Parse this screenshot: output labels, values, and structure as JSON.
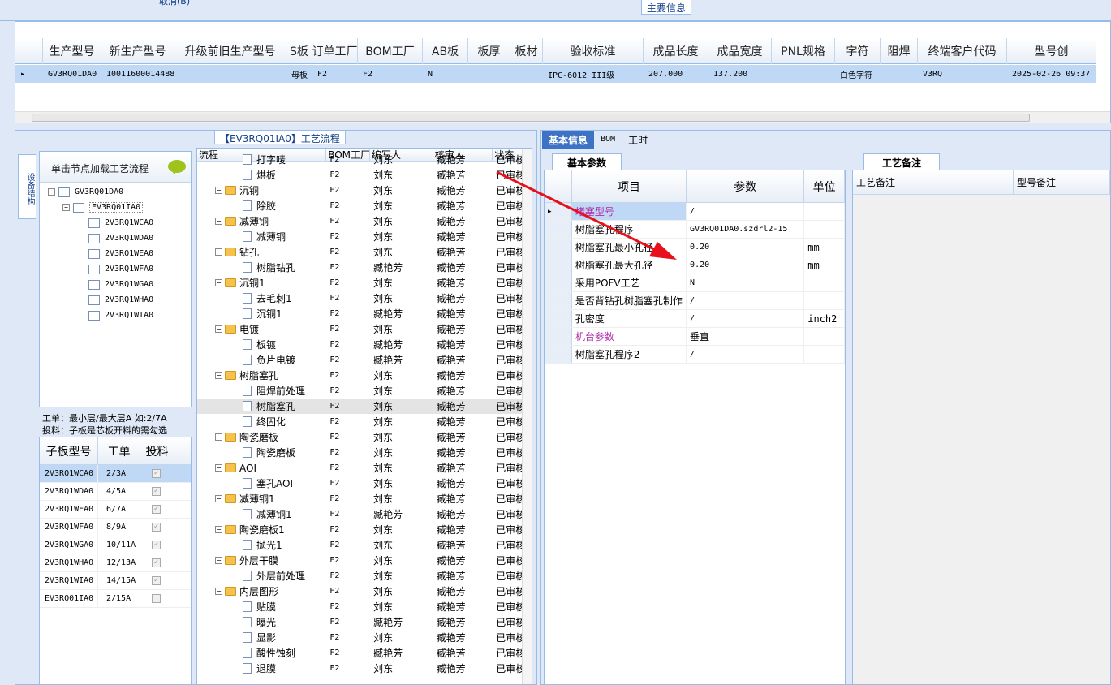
{
  "top": {
    "cancel_label": "取消(B)"
  },
  "main_info": {
    "title": "主要信息",
    "headers": [
      "生产型号",
      "新生产型号",
      "升级前旧生产型号",
      "S板",
      "订单工厂",
      "BOM工厂",
      "AB板",
      "板厚",
      "板材",
      "验收标准",
      "成品长度",
      "成品宽度",
      "PNL规格",
      "字符",
      "阻焊",
      "终端客户代码",
      "型号创"
    ],
    "row": [
      "GV3RQ01DA0",
      "10011600014488",
      "",
      "母板",
      "F2",
      "F2",
      "N",
      "",
      "",
      "IPC-6012 III级",
      "207.000",
      "137.200",
      "",
      "白色字符",
      "",
      "V3RQ",
      "2025-02-26 09:37"
    ]
  },
  "left": {
    "flow_title": "【EV3RQ01IA0】工艺流程",
    "vtab_label": "设备结构",
    "tree_header": "单击节点加载工艺流程",
    "tree": {
      "root": "GV3RQ01DA0",
      "child": "EV3RQ01IA0",
      "leaves": [
        "2V3RQ1WCA0",
        "2V3RQ1WDA0",
        "2V3RQ1WEA0",
        "2V3RQ1WFA0",
        "2V3RQ1WGA0",
        "2V3RQ1WHA0",
        "2V3RQ1WIA0"
      ]
    },
    "info_line1": "工单：最小层/最大层A 如:2/7A",
    "info_line2": "投料：子板是芯板开料的需勾选",
    "sub_grid": {
      "headers": [
        "子板型号",
        "工单",
        "投料"
      ],
      "rows": [
        {
          "model": "2V3RQ1WCA0",
          "order": "2/3A",
          "checked": true
        },
        {
          "model": "2V3RQ1WDA0",
          "order": "4/5A",
          "checked": true
        },
        {
          "model": "2V3RQ1WEA0",
          "order": "6/7A",
          "checked": true
        },
        {
          "model": "2V3RQ1WFA0",
          "order": "8/9A",
          "checked": true
        },
        {
          "model": "2V3RQ1WGA0",
          "order": "10/11A",
          "checked": true
        },
        {
          "model": "2V3RQ1WHA0",
          "order": "12/13A",
          "checked": true
        },
        {
          "model": "2V3RQ1WIA0",
          "order": "14/15A",
          "checked": true
        },
        {
          "model": "EV3RQ01IA0",
          "order": "2/15A",
          "checked": false
        }
      ]
    }
  },
  "process": {
    "headers": [
      "流程",
      "BOM工厂",
      "编写人",
      "核审人",
      "状态"
    ],
    "rows": [
      {
        "level": 2,
        "name": "打字唛",
        "bom": "F2",
        "writer": "刘东",
        "auditor": "臧艳芳",
        "status": "已审核"
      },
      {
        "level": 2,
        "name": "烘板",
        "bom": "F2",
        "writer": "刘东",
        "auditor": "臧艳芳",
        "status": "已审核"
      },
      {
        "level": 1,
        "name": "沉铜",
        "bom": "F2",
        "writer": "刘东",
        "auditor": "臧艳芳",
        "status": "已审核"
      },
      {
        "level": 2,
        "name": "除胶",
        "bom": "F2",
        "writer": "刘东",
        "auditor": "臧艳芳",
        "status": "已审核"
      },
      {
        "level": 1,
        "name": "减薄铜",
        "bom": "F2",
        "writer": "刘东",
        "auditor": "臧艳芳",
        "status": "已审核"
      },
      {
        "level": 2,
        "name": "减薄铜",
        "bom": "F2",
        "writer": "刘东",
        "auditor": "臧艳芳",
        "status": "已审核"
      },
      {
        "level": 1,
        "name": "钻孔",
        "bom": "F2",
        "writer": "刘东",
        "auditor": "臧艳芳",
        "status": "已审核"
      },
      {
        "level": 2,
        "name": "树脂钻孔",
        "bom": "F2",
        "writer": "臧艳芳",
        "auditor": "臧艳芳",
        "status": "已审核"
      },
      {
        "level": 1,
        "name": "沉铜1",
        "bom": "F2",
        "writer": "刘东",
        "auditor": "臧艳芳",
        "status": "已审核"
      },
      {
        "level": 2,
        "name": "去毛刺1",
        "bom": "F2",
        "writer": "刘东",
        "auditor": "臧艳芳",
        "status": "已审核"
      },
      {
        "level": 2,
        "name": "沉铜1",
        "bom": "F2",
        "writer": "臧艳芳",
        "auditor": "臧艳芳",
        "status": "已审核"
      },
      {
        "level": 1,
        "name": "电镀",
        "bom": "F2",
        "writer": "刘东",
        "auditor": "臧艳芳",
        "status": "已审核"
      },
      {
        "level": 2,
        "name": "板镀",
        "bom": "F2",
        "writer": "臧艳芳",
        "auditor": "臧艳芳",
        "status": "已审核"
      },
      {
        "level": 2,
        "name": "负片电镀",
        "bom": "F2",
        "writer": "臧艳芳",
        "auditor": "臧艳芳",
        "status": "已审核"
      },
      {
        "level": 1,
        "name": "树脂塞孔",
        "bom": "F2",
        "writer": "刘东",
        "auditor": "臧艳芳",
        "status": "已审核"
      },
      {
        "level": 2,
        "name": "阻焊前处理",
        "bom": "F2",
        "writer": "刘东",
        "auditor": "臧艳芳",
        "status": "已审核"
      },
      {
        "level": 2,
        "name": "树脂塞孔",
        "bom": "F2",
        "writer": "刘东",
        "auditor": "臧艳芳",
        "status": "已审核",
        "selected": true
      },
      {
        "level": 2,
        "name": "终固化",
        "bom": "F2",
        "writer": "刘东",
        "auditor": "臧艳芳",
        "status": "已审核"
      },
      {
        "level": 1,
        "name": "陶瓷磨板",
        "bom": "F2",
        "writer": "刘东",
        "auditor": "臧艳芳",
        "status": "已审核"
      },
      {
        "level": 2,
        "name": "陶瓷磨板",
        "bom": "F2",
        "writer": "刘东",
        "auditor": "臧艳芳",
        "status": "已审核"
      },
      {
        "level": 1,
        "name": "AOI",
        "bom": "F2",
        "writer": "刘东",
        "auditor": "臧艳芳",
        "status": "已审核"
      },
      {
        "level": 2,
        "name": "塞孔AOI",
        "bom": "F2",
        "writer": "刘东",
        "auditor": "臧艳芳",
        "status": "已审核"
      },
      {
        "level": 1,
        "name": "减薄铜1",
        "bom": "F2",
        "writer": "刘东",
        "auditor": "臧艳芳",
        "status": "已审核"
      },
      {
        "level": 2,
        "name": "减薄铜1",
        "bom": "F2",
        "writer": "臧艳芳",
        "auditor": "臧艳芳",
        "status": "已审核"
      },
      {
        "level": 1,
        "name": "陶瓷磨板1",
        "bom": "F2",
        "writer": "刘东",
        "auditor": "臧艳芳",
        "status": "已审核"
      },
      {
        "level": 2,
        "name": "抛光1",
        "bom": "F2",
        "writer": "刘东",
        "auditor": "臧艳芳",
        "status": "已审核"
      },
      {
        "level": 1,
        "name": "外层干膜",
        "bom": "F2",
        "writer": "刘东",
        "auditor": "臧艳芳",
        "status": "已审核"
      },
      {
        "level": 2,
        "name": "外层前处理",
        "bom": "F2",
        "writer": "刘东",
        "auditor": "臧艳芳",
        "status": "已审核"
      },
      {
        "level": 1,
        "name": "内层图形",
        "bom": "F2",
        "writer": "刘东",
        "auditor": "臧艳芳",
        "status": "已审核"
      },
      {
        "level": 2,
        "name": "贴膜",
        "bom": "F2",
        "writer": "刘东",
        "auditor": "臧艳芳",
        "status": "已审核"
      },
      {
        "level": 2,
        "name": "曝光",
        "bom": "F2",
        "writer": "臧艳芳",
        "auditor": "臧艳芳",
        "status": "已审核"
      },
      {
        "level": 2,
        "name": "显影",
        "bom": "F2",
        "writer": "刘东",
        "auditor": "臧艳芳",
        "status": "已审核"
      },
      {
        "level": 2,
        "name": "酸性蚀刻",
        "bom": "F2",
        "writer": "臧艳芳",
        "auditor": "臧艳芳",
        "status": "已审核"
      },
      {
        "level": 2,
        "name": "退膜",
        "bom": "F2",
        "writer": "刘东",
        "auditor": "臧艳芳",
        "status": "已审核"
      }
    ]
  },
  "right": {
    "tabs": [
      "基本信息",
      "BOM",
      "工时"
    ],
    "subtab_basic": "基本参数",
    "param_headers": [
      "项目",
      "参数",
      "单位"
    ],
    "params": [
      {
        "item": "堵塞型号",
        "value": "/",
        "unit": "",
        "color": "#b02aa8",
        "hl": true
      },
      {
        "item": "树脂塞孔程序",
        "value": "GV3RQ01DA0.szdrl2-15",
        "unit": ""
      },
      {
        "item": "树脂塞孔最小孔径",
        "value": "0.20",
        "unit": "mm"
      },
      {
        "item": "树脂塞孔最大孔径",
        "value": "0.20",
        "unit": "mm"
      },
      {
        "item": "采用POFV工艺",
        "value": "N",
        "unit": ""
      },
      {
        "item": "是否背钻孔树脂塞孔制作",
        "value": "/",
        "unit": ""
      },
      {
        "item": "孔密度",
        "value": "/",
        "unit": "inch2"
      },
      {
        "item": "机台参数",
        "value": "垂直",
        "unit": "",
        "color": "#b02aa8"
      },
      {
        "item": "树脂塞孔程序2",
        "value": "/",
        "unit": ""
      }
    ],
    "subtab_note": "工艺备注",
    "note_headers": [
      "工艺备注",
      "型号备注"
    ]
  },
  "colors": {
    "accent": "#3d72c4",
    "border": "#99bbe8",
    "arrow": "#e8101a",
    "selection": "#bfd8f5"
  }
}
